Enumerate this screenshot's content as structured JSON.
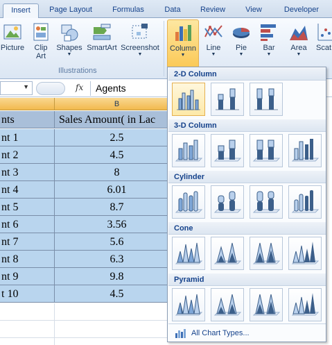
{
  "tabs": [
    {
      "label": "Insert",
      "active": true
    },
    {
      "label": "Page Layout",
      "active": false
    },
    {
      "label": "Formulas",
      "active": false
    },
    {
      "label": "Data",
      "active": false
    },
    {
      "label": "Review",
      "active": false
    },
    {
      "label": "View",
      "active": false
    },
    {
      "label": "Developer",
      "active": false
    }
  ],
  "ribbon": {
    "illustrations": {
      "buttons": [
        {
          "label": "Picture",
          "icon": "picture-icon"
        },
        {
          "label": "Clip Art",
          "icon": "clip-art-icon"
        },
        {
          "label": "Shapes",
          "icon": "shapes-icon"
        },
        {
          "label": "SmartArt",
          "icon": "smartart-icon"
        },
        {
          "label": "Screenshot",
          "icon": "screenshot-icon"
        }
      ],
      "group_label": "Illustrations"
    },
    "charts": {
      "buttons": [
        {
          "label": "Column",
          "icon": "column-chart-icon",
          "active": true
        },
        {
          "label": "Line",
          "icon": "line-chart-icon"
        },
        {
          "label": "Pie",
          "icon": "pie-chart-icon"
        },
        {
          "label": "Bar",
          "icon": "bar-chart-icon"
        },
        {
          "label": "Area",
          "icon": "area-chart-icon"
        },
        {
          "label": "Scat",
          "icon": "scatter-chart-icon"
        }
      ]
    },
    "clip_art_line2": "Art"
  },
  "formula_bar": {
    "name_box_value": "",
    "fx_label": "fx",
    "content": "Agents"
  },
  "sheet": {
    "column_b_header": "B",
    "header_row": {
      "a": "nts",
      "b": "Sales Amount( in Lac"
    },
    "rows": [
      {
        "a": "nt 1",
        "b": "2.5"
      },
      {
        "a": "nt 2",
        "b": "4.5"
      },
      {
        "a": "nt 3",
        "b": "8"
      },
      {
        "a": "nt 4",
        "b": "6.01"
      },
      {
        "a": "nt 5",
        "b": "8.7"
      },
      {
        "a": "nt 6",
        "b": "3.56"
      },
      {
        "a": "nt 7",
        "b": "5.6"
      },
      {
        "a": "nt 8",
        "b": "6.3"
      },
      {
        "a": "nt 9",
        "b": "9.8"
      },
      {
        "a": "t 10",
        "b": "4.5"
      }
    ]
  },
  "gallery": {
    "sections": [
      {
        "title": "2-D Column",
        "items": [
          "clustered-column",
          "stacked-column",
          "100-stacked-column"
        ]
      },
      {
        "title": "3-D Column",
        "items": [
          "3d-clustered-column",
          "3d-stacked-column",
          "3d-100-stacked-column",
          "3d-column"
        ]
      },
      {
        "title": "Cylinder",
        "items": [
          "clustered-cylinder",
          "stacked-cylinder",
          "100-stacked-cylinder",
          "3d-cylinder"
        ]
      },
      {
        "title": "Cone",
        "items": [
          "clustered-cone",
          "stacked-cone",
          "100-stacked-cone",
          "3d-cone"
        ]
      },
      {
        "title": "Pyramid",
        "items": [
          "clustered-pyramid",
          "stacked-pyramid",
          "100-stacked-pyramid",
          "3d-pyramid"
        ]
      }
    ],
    "all_chart_types": "All Chart Types..."
  },
  "colors": {
    "accent": "#f2b94e",
    "selection_fill": "#b9d5ee",
    "ribbon_text": "#15428b"
  }
}
